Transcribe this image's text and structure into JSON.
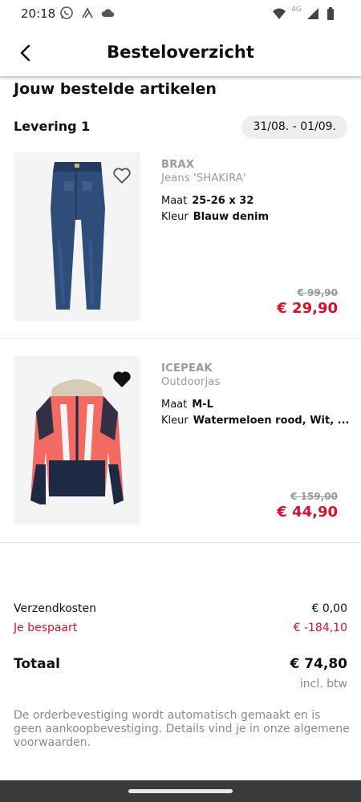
{
  "status_bar": {
    "time": "20:18",
    "network_label": "4G",
    "left_icons": [
      "whatsapp-icon",
      "app-notification-icon",
      "cloud-icon"
    ],
    "right_icons": [
      "wifi-icon",
      "cellular-signal-icon",
      "battery-icon"
    ]
  },
  "header": {
    "title": "Besteloverzicht",
    "back_icon": "chevron-left-icon"
  },
  "order": {
    "section_title": "Jouw bestelde artikelen",
    "delivery_label": "Levering 1",
    "delivery_date": "31/08. - 01/09.",
    "items": [
      {
        "brand": "BRAX",
        "name": "Jeans 'SHAKIRA'",
        "size_label": "Maat",
        "size": "25-26 x 32",
        "color_label": "Kleur",
        "color": "Blauw denim",
        "old_price": "€ 99,90",
        "price": "€ 29,90",
        "wishlisted": false,
        "wishlist_icon": "heart-outline-icon"
      },
      {
        "brand": "ICEPEAK",
        "name": "Outdoorjas",
        "size_label": "Maat",
        "size": "M-L",
        "color_label": "Kleur",
        "color": "Watermeloen rood, Wit, ...",
        "old_price": "€ 159,00",
        "price": "€ 44,90",
        "wishlisted": true,
        "wishlist_icon": "heart-filled-icon"
      }
    ]
  },
  "summary": {
    "shipping_label": "Verzendkosten",
    "shipping_value": "€ 0,00",
    "savings_label": "Je bespaart",
    "savings_value": "€ -184,10",
    "total_label": "Totaal",
    "total_value": "€ 74,80",
    "vat_note": "incl. btw",
    "disclaimer": "De orderbevestiging wordt automatisch gemaakt en is geen aankoopbevestiging. Details vind je in onze algemene voorwaarden."
  },
  "colors": {
    "sale_red": "#d8112b",
    "muted_grey": "#9a9a9a",
    "nav_bar": "#3a3a3c"
  }
}
